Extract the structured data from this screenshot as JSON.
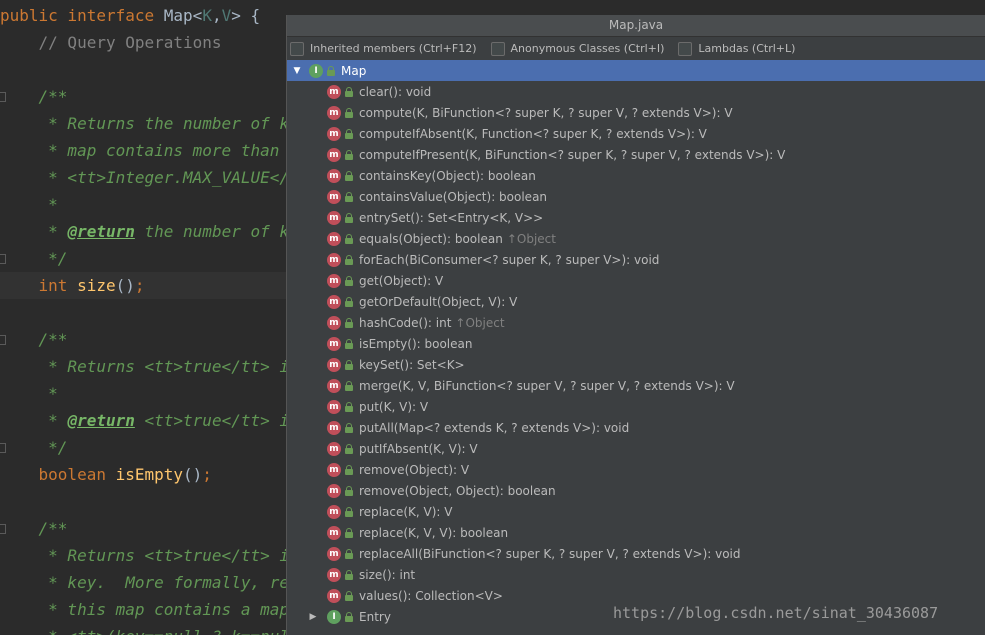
{
  "editor": {
    "lines": [
      {
        "segments": [
          {
            "t": "public ",
            "c": "kw"
          },
          {
            "t": "interface ",
            "c": "kw"
          },
          {
            "t": "Map",
            "c": ""
          },
          {
            "t": "<",
            "c": ""
          },
          {
            "t": "K",
            "c": "ty"
          },
          {
            "t": ",",
            "c": ""
          },
          {
            "t": "V",
            "c": "ty"
          },
          {
            "t": "> {",
            "c": ""
          }
        ]
      },
      {
        "segments": [
          {
            "t": "    // Query Operations",
            "c": "cm"
          }
        ]
      },
      {
        "segments": []
      },
      {
        "segments": [
          {
            "t": "    /**",
            "c": "doc"
          }
        ],
        "mark": true
      },
      {
        "segments": [
          {
            "t": "     * Returns the number of key",
            "c": "doc"
          }
        ]
      },
      {
        "segments": [
          {
            "t": "     * map contains more than <",
            "c": "doc"
          }
        ]
      },
      {
        "segments": [
          {
            "t": "     * <tt>Integer.MAX_VALUE</t",
            "c": "doc"
          }
        ]
      },
      {
        "segments": [
          {
            "t": "     *",
            "c": "doc"
          }
        ]
      },
      {
        "segments": [
          {
            "t": "     * ",
            "c": "doc"
          },
          {
            "t": "@return",
            "c": "tag"
          },
          {
            "t": " the number of ke",
            "c": "doc"
          }
        ]
      },
      {
        "segments": [
          {
            "t": "     */",
            "c": "doc"
          }
        ],
        "mark": true
      },
      {
        "segments": [
          {
            "t": "    int ",
            "c": "kw"
          },
          {
            "t": "size",
            "c": "mth"
          },
          {
            "t": "()",
            "c": ""
          },
          {
            "t": ";",
            "c": "kw"
          }
        ],
        "current": true
      },
      {
        "segments": []
      },
      {
        "segments": [
          {
            "t": "    /**",
            "c": "doc"
          }
        ],
        "mark": true
      },
      {
        "segments": [
          {
            "t": "     * Returns <tt>true</tt> if",
            "c": "doc"
          }
        ]
      },
      {
        "segments": [
          {
            "t": "     *",
            "c": "doc"
          }
        ]
      },
      {
        "segments": [
          {
            "t": "     * ",
            "c": "doc"
          },
          {
            "t": "@return",
            "c": "tag"
          },
          {
            "t": " <tt>true</tt> if",
            "c": "doc"
          }
        ]
      },
      {
        "segments": [
          {
            "t": "     */",
            "c": "doc"
          }
        ],
        "mark": true
      },
      {
        "segments": [
          {
            "t": "    boolean ",
            "c": "kw"
          },
          {
            "t": "isEmpty",
            "c": "mth"
          },
          {
            "t": "()",
            "c": ""
          },
          {
            "t": ";",
            "c": "kw"
          }
        ]
      },
      {
        "segments": []
      },
      {
        "segments": [
          {
            "t": "    /**",
            "c": "doc"
          }
        ],
        "mark": true
      },
      {
        "segments": [
          {
            "t": "     * Returns <tt>true</tt> if",
            "c": "doc"
          }
        ]
      },
      {
        "segments": [
          {
            "t": "     * key.  More formally, retu",
            "c": "doc"
          }
        ]
      },
      {
        "segments": [
          {
            "t": "     * this map contains a mappi",
            "c": "doc"
          }
        ]
      },
      {
        "segments": [
          {
            "t": "     * <tt>(key==null ? k==null",
            "c": "doc"
          }
        ]
      }
    ]
  },
  "popup": {
    "title": "Map.java",
    "options": [
      {
        "label": "Inherited members (Ctrl+F12)",
        "checked": false
      },
      {
        "label": "Anonymous Classes (Ctrl+I)",
        "checked": false
      },
      {
        "label": "Lambdas (Ctrl+L)",
        "checked": false
      }
    ],
    "root": {
      "label": "Map",
      "badge": "I",
      "expanded": true
    },
    "members": [
      {
        "sig": "clear(): void"
      },
      {
        "sig": "compute(K, BiFunction<? super K, ? super V, ? extends V>): V"
      },
      {
        "sig": "computeIfAbsent(K, Function<? super K, ? extends V>): V"
      },
      {
        "sig": "computeIfPresent(K, BiFunction<? super K, ? super V, ? extends V>): V"
      },
      {
        "sig": "containsKey(Object): boolean"
      },
      {
        "sig": "containsValue(Object): boolean"
      },
      {
        "sig": "entrySet(): Set<Entry<K, V>>"
      },
      {
        "sig": "equals(Object): boolean",
        "inherited": "↑Object"
      },
      {
        "sig": "forEach(BiConsumer<? super K, ? super V>): void"
      },
      {
        "sig": "get(Object): V"
      },
      {
        "sig": "getOrDefault(Object, V): V"
      },
      {
        "sig": "hashCode(): int",
        "inherited": "↑Object"
      },
      {
        "sig": "isEmpty(): boolean"
      },
      {
        "sig": "keySet(): Set<K>"
      },
      {
        "sig": "merge(K, V, BiFunction<? super V, ? super V, ? extends V>): V"
      },
      {
        "sig": "put(K, V): V"
      },
      {
        "sig": "putAll(Map<? extends K, ? extends V>): void"
      },
      {
        "sig": "putIfAbsent(K, V): V"
      },
      {
        "sig": "remove(Object): V"
      },
      {
        "sig": "remove(Object, Object): boolean"
      },
      {
        "sig": "replace(K, V): V"
      },
      {
        "sig": "replace(K, V, V): boolean"
      },
      {
        "sig": "replaceAll(BiFunction<? super K, ? super V, ? extends V>): void"
      },
      {
        "sig": "size(): int"
      },
      {
        "sig": "values(): Collection<V>"
      }
    ],
    "nested": {
      "label": "Entry",
      "badge": "I",
      "expanded": false
    }
  },
  "icons": {
    "method_badge": "m",
    "interface_badge": "I",
    "expand_arrow": "▼",
    "collapse_arrow": "▶"
  },
  "colors": {
    "selection": "#4b6eaf",
    "method_badge": "#c04f5a",
    "interface_badge": "#5fa05f"
  },
  "watermark": "https://blog.csdn.net/sinat_30436087"
}
